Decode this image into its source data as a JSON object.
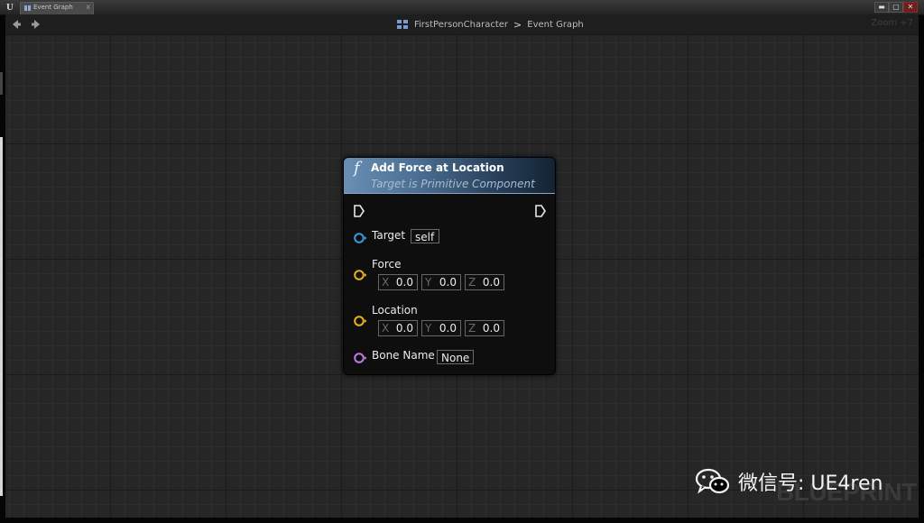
{
  "window": {
    "tab_label": "Event Graph",
    "tab_close": "x",
    "min_glyph": "▬",
    "max_glyph": "▢",
    "close_glyph": "✕",
    "logo": "U"
  },
  "toolbar": {
    "breadcrumb": {
      "icon": "blueprint-grid-icon",
      "items": [
        "FirstPersonCharacter",
        "Event Graph"
      ],
      "separator": ">"
    },
    "zoom": "Zoom +7",
    "back_icon": "back-arrow-icon",
    "forward_icon": "forward-arrow-icon"
  },
  "node": {
    "icon": "f",
    "title": "Add Force at Location",
    "subtitle": "Target is Primitive Component",
    "pins": {
      "target": {
        "label": "Target",
        "value": "self",
        "color": "#3b9ad9"
      },
      "force": {
        "label": "Force",
        "x_label": "X",
        "x": "0.0",
        "y_label": "Y",
        "y": "0.0",
        "z_label": "Z",
        "z": "0.0",
        "color": "#e6b317"
      },
      "location": {
        "label": "Location",
        "x_label": "X",
        "x": "0.0",
        "y_label": "Y",
        "y": "0.0",
        "z_label": "Z",
        "z": "0.0",
        "color": "#e6b317"
      },
      "bone_name": {
        "label": "Bone Name",
        "value": "None",
        "color": "#c07be0"
      }
    }
  },
  "watermarks": {
    "graph": "BLUEPRINT",
    "wechat": "微信号: UE4ren"
  }
}
